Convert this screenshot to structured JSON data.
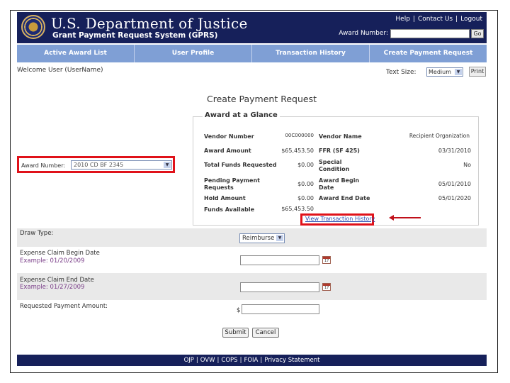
{
  "header": {
    "title": "U.S. Department of Justice",
    "subtitle": "Grant Payment Request System (GPRS)",
    "links": [
      "Help",
      "Contact Us",
      "Logout"
    ],
    "award_search_label": "Award Number:",
    "award_search_value": "",
    "go_label": "Go"
  },
  "nav": {
    "tabs": [
      "Active Award List",
      "User Profile",
      "Transaction History",
      "Create Payment Request"
    ]
  },
  "welcome": "Welcome User (UserName)",
  "text_size": {
    "label": "Text Size:",
    "value": "Medium",
    "print_label": "Print"
  },
  "page_title": "Create Payment Request",
  "award_number": {
    "label": "Award Number:",
    "value": "2010 CD BF 2345"
  },
  "glance": {
    "legend": "Award at a Glance",
    "vendor_number_label": "Vendor Number",
    "vendor_number_value": "00C000000",
    "vendor_name_label": "Vendor Name",
    "vendor_name_value": "Recipient Organization",
    "award_amount_label": "Award Amount",
    "award_amount_value": "$65,453.50",
    "ffr_label": "FFR (SF 425)",
    "ffr_value": "03/31/2010",
    "total_funds_label": "Total Funds Requested",
    "total_funds_value": "$0.00",
    "special_condition_label": "Special Condition",
    "special_condition_value": "No",
    "pending_label": "Pending Payment Requests",
    "pending_value": "$0.00",
    "award_begin_label": "Award Begin Date",
    "award_begin_value": "05/01/2010",
    "hold_label": "Hold Amount",
    "hold_value": "$0.00",
    "award_end_label": "Award End Date",
    "award_end_value": "05/01/2020",
    "funds_available_label": "Funds Available",
    "funds_available_value": "$65,453.50",
    "view_history_link": "View Transaction History"
  },
  "form": {
    "draw_type_label": "Draw Type:",
    "draw_type_value": "Reimburse",
    "begin_label": "Expense Claim Begin Date",
    "begin_example": "Example: 01/20/2009",
    "begin_value": "",
    "end_label": "Expense Claim End Date",
    "end_example": "Example: 01/27/2009",
    "end_value": "",
    "amount_label": "Requested Payment Amount:",
    "currency_symbol": "$",
    "amount_value": "",
    "submit_label": "Submit",
    "cancel_label": "Cancel",
    "calendar_glyph": "17"
  },
  "footer": {
    "links": [
      "OJP",
      "OVW",
      "COPS",
      "FOIA",
      "Privacy Statement"
    ]
  },
  "colors": {
    "header_bg": "#16205a",
    "nav_bg": "#7f9fd5",
    "highlight_red": "#e0121a",
    "link_blue": "#2a4db0"
  }
}
